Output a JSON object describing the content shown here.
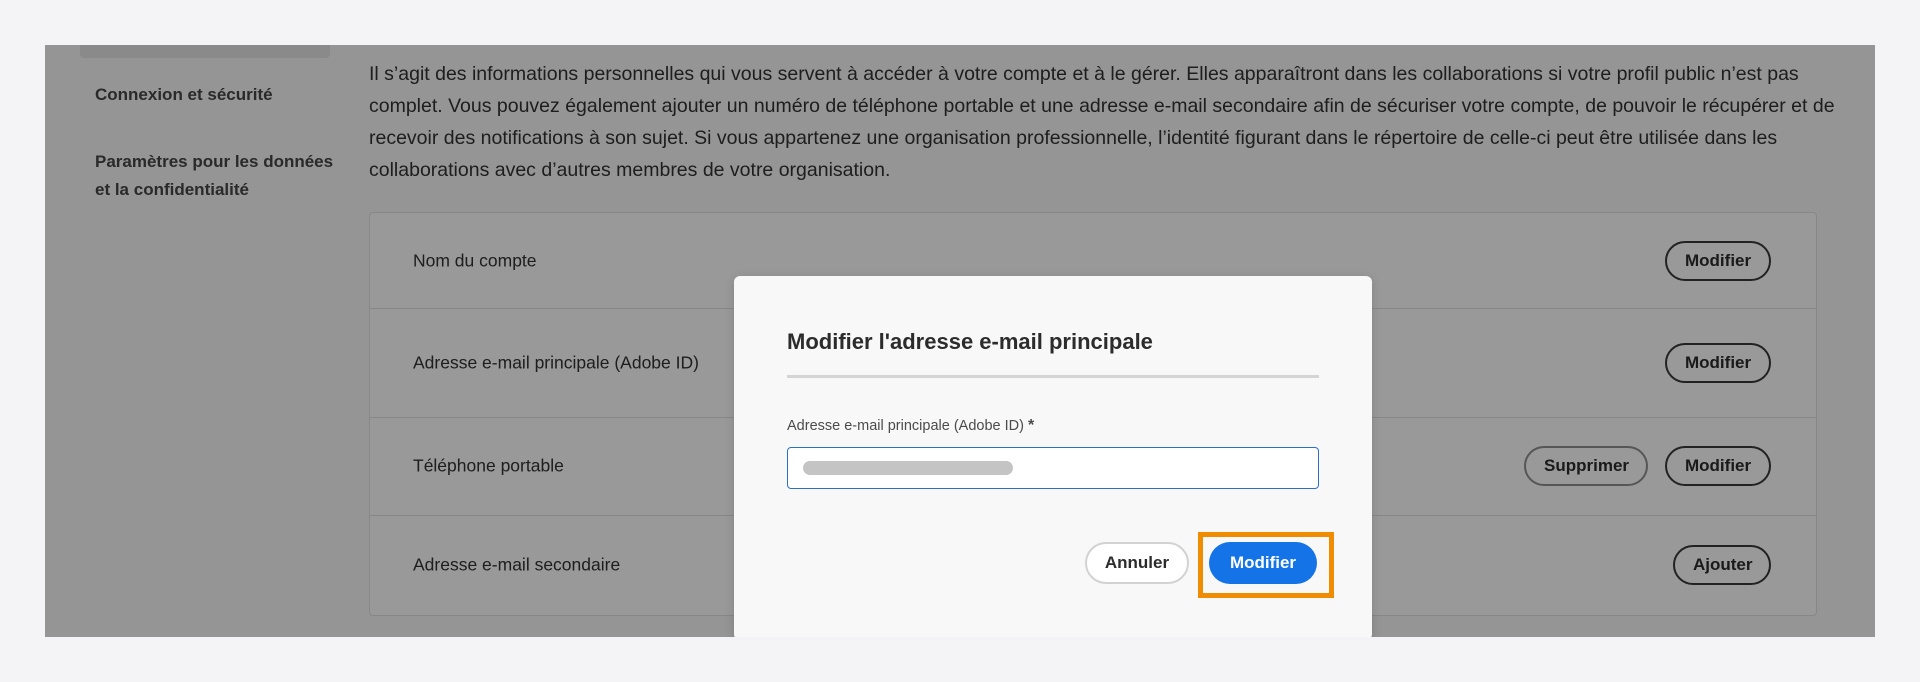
{
  "sidebar": {
    "items": [
      {
        "label": "Connexion et sécurité"
      },
      {
        "label": "Paramètres pour les données et la confidentialité"
      }
    ]
  },
  "intro": {
    "text": "Il s’agit des informations personnelles qui vous servent à accéder à votre compte et à le gérer. Elles apparaîtront dans les collaborations si votre profil public n’est pas complet. Vous pouvez également ajouter un numéro de téléphone portable et une adresse e-mail secondaire afin de sécuriser votre compte, de pouvoir le récupérer et de recevoir des notifications à son sujet. Si vous appartenez une organisation professionnelle, l’identité figurant dans le répertoire de celle-ci peut être utilisée dans les collaborations avec d’autres membres de votre organisation."
  },
  "settings": {
    "rows": [
      {
        "label": "Nom du compte",
        "edit_label": "Modifier"
      },
      {
        "label": "Adresse e-mail principale (Adobe ID)",
        "edit_label": "Modifier"
      },
      {
        "label": "Téléphone portable",
        "delete_label": "Supprimer",
        "edit_label": "Modifier"
      },
      {
        "label": "Adresse e-mail secondaire",
        "add_label": "Ajouter"
      }
    ]
  },
  "dialog": {
    "title": "Modifier l'adresse e-mail principale",
    "field_label": "Adresse e-mail principale (Adobe ID)",
    "required_marker": "*",
    "email_value": "",
    "cancel_label": "Annuler",
    "confirm_label": "Modifier"
  },
  "colors": {
    "accent": "#1473e6",
    "highlight": "#f08c00"
  }
}
